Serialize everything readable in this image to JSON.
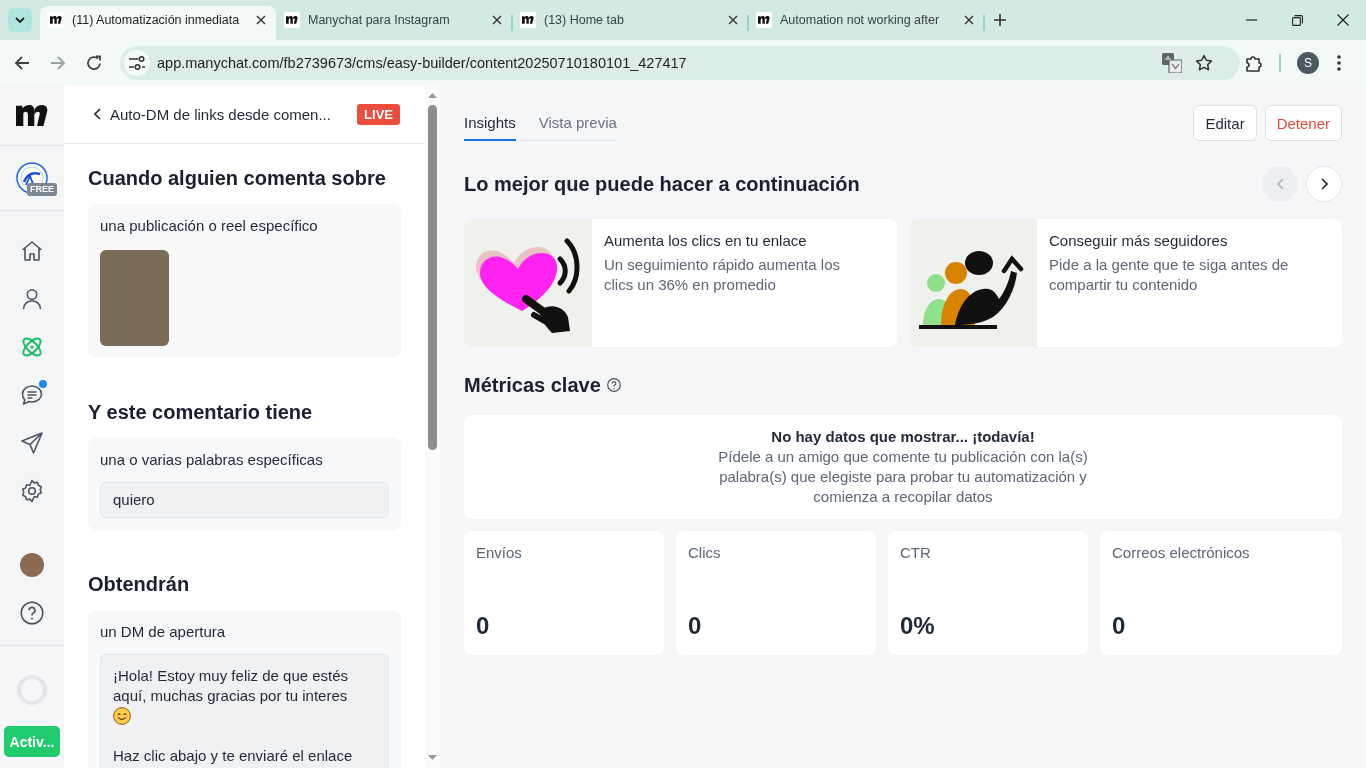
{
  "browser": {
    "tabs": [
      {
        "title": "(11) Automatización inmediata",
        "selected": true
      },
      {
        "title": "Manychat para Instagram",
        "selected": false
      },
      {
        "title": "(13) Home tab",
        "selected": false
      },
      {
        "title": "Automation not working after",
        "selected": false
      }
    ],
    "url": "app.manychat.com/fb2739673/cms/easy-builder/content20250710180101_427417",
    "profile_initial": "S"
  },
  "nav": {
    "plan_badge": "FREE",
    "items": [
      {
        "kind": "home",
        "selected": false,
        "notification": false
      },
      {
        "kind": "contacts",
        "selected": false,
        "notification": false
      },
      {
        "kind": "automations",
        "selected": true,
        "notification": false
      },
      {
        "kind": "chats",
        "selected": false,
        "notification": true
      },
      {
        "kind": "broadcasts",
        "selected": false,
        "notification": false
      },
      {
        "kind": "settings",
        "selected": false,
        "notification": false
      }
    ],
    "activate_button": "Activ..."
  },
  "panel": {
    "title": "Auto-DM de links desde comen...",
    "status": "LIVE",
    "sections": [
      {
        "kind": "post",
        "heading": "Cuando alguien comenta sobre",
        "label": "una publicación o reel específico"
      },
      {
        "kind": "keywords",
        "heading": "Y este comentario tiene",
        "label": "una o varias palabras específicas",
        "value": "quiero"
      },
      {
        "kind": "message",
        "heading": "Obtendrán",
        "label": "un DM de apertura",
        "paragraphs": [
          "¡Hola! Estoy muy feliz de que estés aquí, muchas gracias por tu interes",
          "Haz clic abajo y te enviaré el enlace"
        ]
      }
    ]
  },
  "main": {
    "tabs": [
      {
        "label": "Insights",
        "selected": true
      },
      {
        "label": "Vista previa",
        "selected": false
      }
    ],
    "buttons": [
      {
        "label": "Editar",
        "kind": "default"
      },
      {
        "label": "Detener",
        "kind": "danger"
      }
    ],
    "next_steps": {
      "heading": "Lo mejor que puede hacer a continuación",
      "previous_disabled": true,
      "next_disabled": false,
      "cards": [
        {
          "kind": "clicks",
          "title": "Aumenta los clics en tu enlace",
          "text": "Un seguimiento rápido aumenta los clics un 36% en promedio"
        },
        {
          "kind": "followers",
          "title": "Conseguir más seguidores",
          "text": "Pide a la gente que te siga antes de compartir tu contenido"
        }
      ]
    },
    "metrics": {
      "heading": "Métricas clave",
      "empty_title": "No hay datos que mostrar... ¡todavía!",
      "empty_text": "Pídele a un amigo que comente tu publicación con la(s) palabra(s) que elegiste para probar tu automatización y comienza a recopilar datos",
      "items": [
        {
          "label": "Envíos",
          "value": "0"
        },
        {
          "label": "Clics",
          "value": "0"
        },
        {
          "label": "CTR",
          "value": "0%"
        },
        {
          "label": "Correos electrónicos",
          "value": "0"
        }
      ]
    }
  }
}
